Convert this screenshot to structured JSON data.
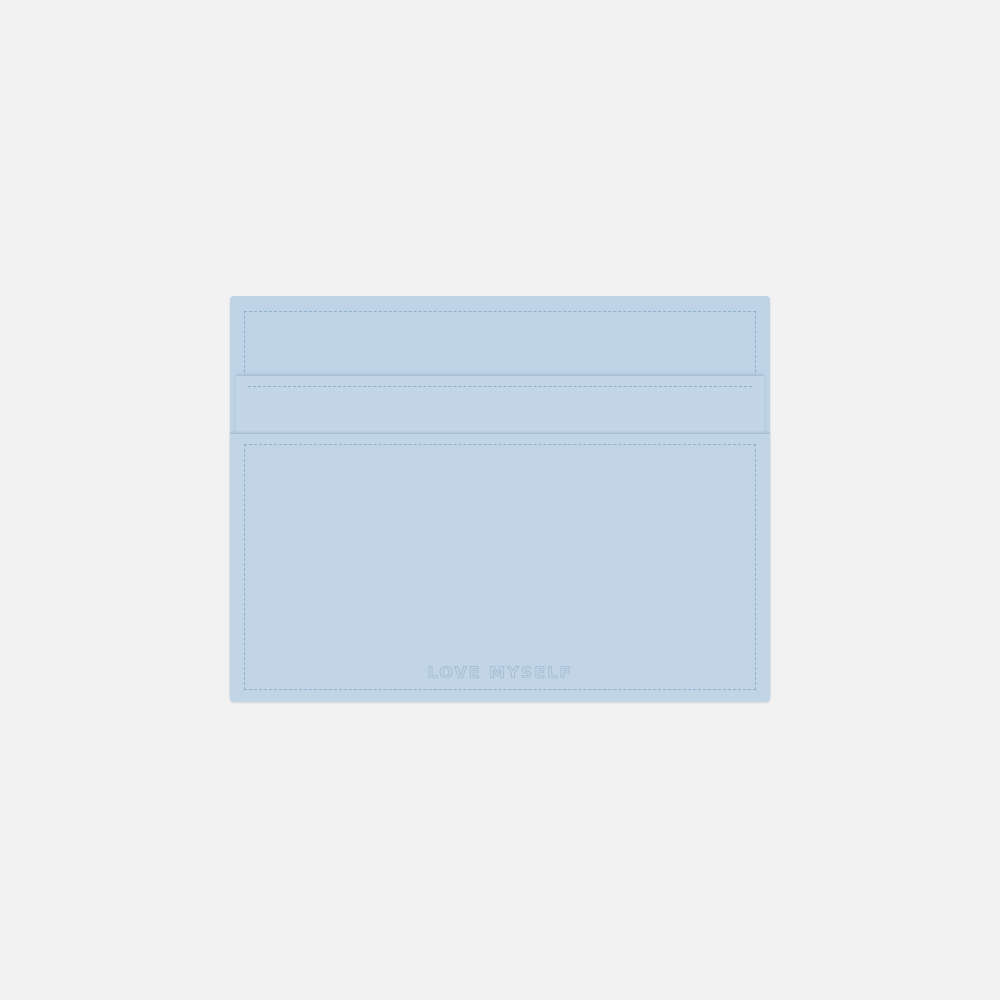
{
  "product": {
    "emboss_text": "LOVE MYSELF",
    "leather_color": "#bfd3e6",
    "stitch_color": "#8fb0cc",
    "background_color": "#f2f2f3"
  }
}
